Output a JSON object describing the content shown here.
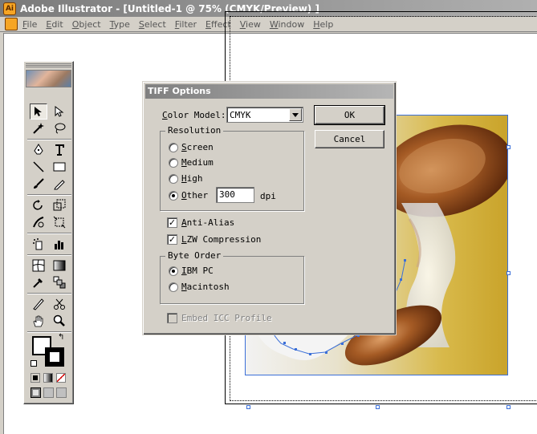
{
  "window": {
    "title": "Adobe Illustrator - [Untitled-1 @ 75% (CMYK/Preview) ]"
  },
  "menu": {
    "items": [
      "File",
      "Edit",
      "Object",
      "Type",
      "Select",
      "Filter",
      "Effect",
      "View",
      "Window",
      "Help"
    ]
  },
  "toolbox": {
    "tools": [
      "selection-tool",
      "direct-selection-tool",
      "magic-wand-tool",
      "lasso-tool",
      "pen-tool",
      "type-tool",
      "line-tool",
      "rectangle-tool",
      "paintbrush-tool",
      "pencil-tool",
      "rotate-tool",
      "scale-tool",
      "warp-tool",
      "free-transform-tool",
      "symbol-sprayer-tool",
      "graph-tool",
      "mesh-tool",
      "gradient-tool",
      "eyedropper-tool",
      "blend-tool",
      "slice-tool",
      "scissors-tool",
      "hand-tool",
      "zoom-tool"
    ]
  },
  "dialog": {
    "title": "TIFF Options",
    "color_model_label": "Color Model:",
    "color_model_value": "CMYK",
    "ok_label": "OK",
    "cancel_label": "Cancel",
    "resolution": {
      "legend": "Resolution",
      "options": [
        "Screen",
        "Medium",
        "High",
        "Other"
      ],
      "selected": "Other",
      "other_value": "300",
      "unit": "dpi"
    },
    "anti_alias_label": "Anti-Alias",
    "anti_alias_checked": true,
    "lzw_label": "LZW Compression",
    "lzw_checked": true,
    "byte_order": {
      "legend": "Byte Order",
      "options": [
        "IBM PC",
        "Macintosh"
      ],
      "selected": "IBM PC"
    },
    "embed_icc_label": "Embed ICC Profile",
    "embed_icc_checked": false,
    "embed_icc_enabled": false
  },
  "colors": {
    "selection": "#3b6fd8",
    "dialog_bg": "#d4d0c8"
  }
}
